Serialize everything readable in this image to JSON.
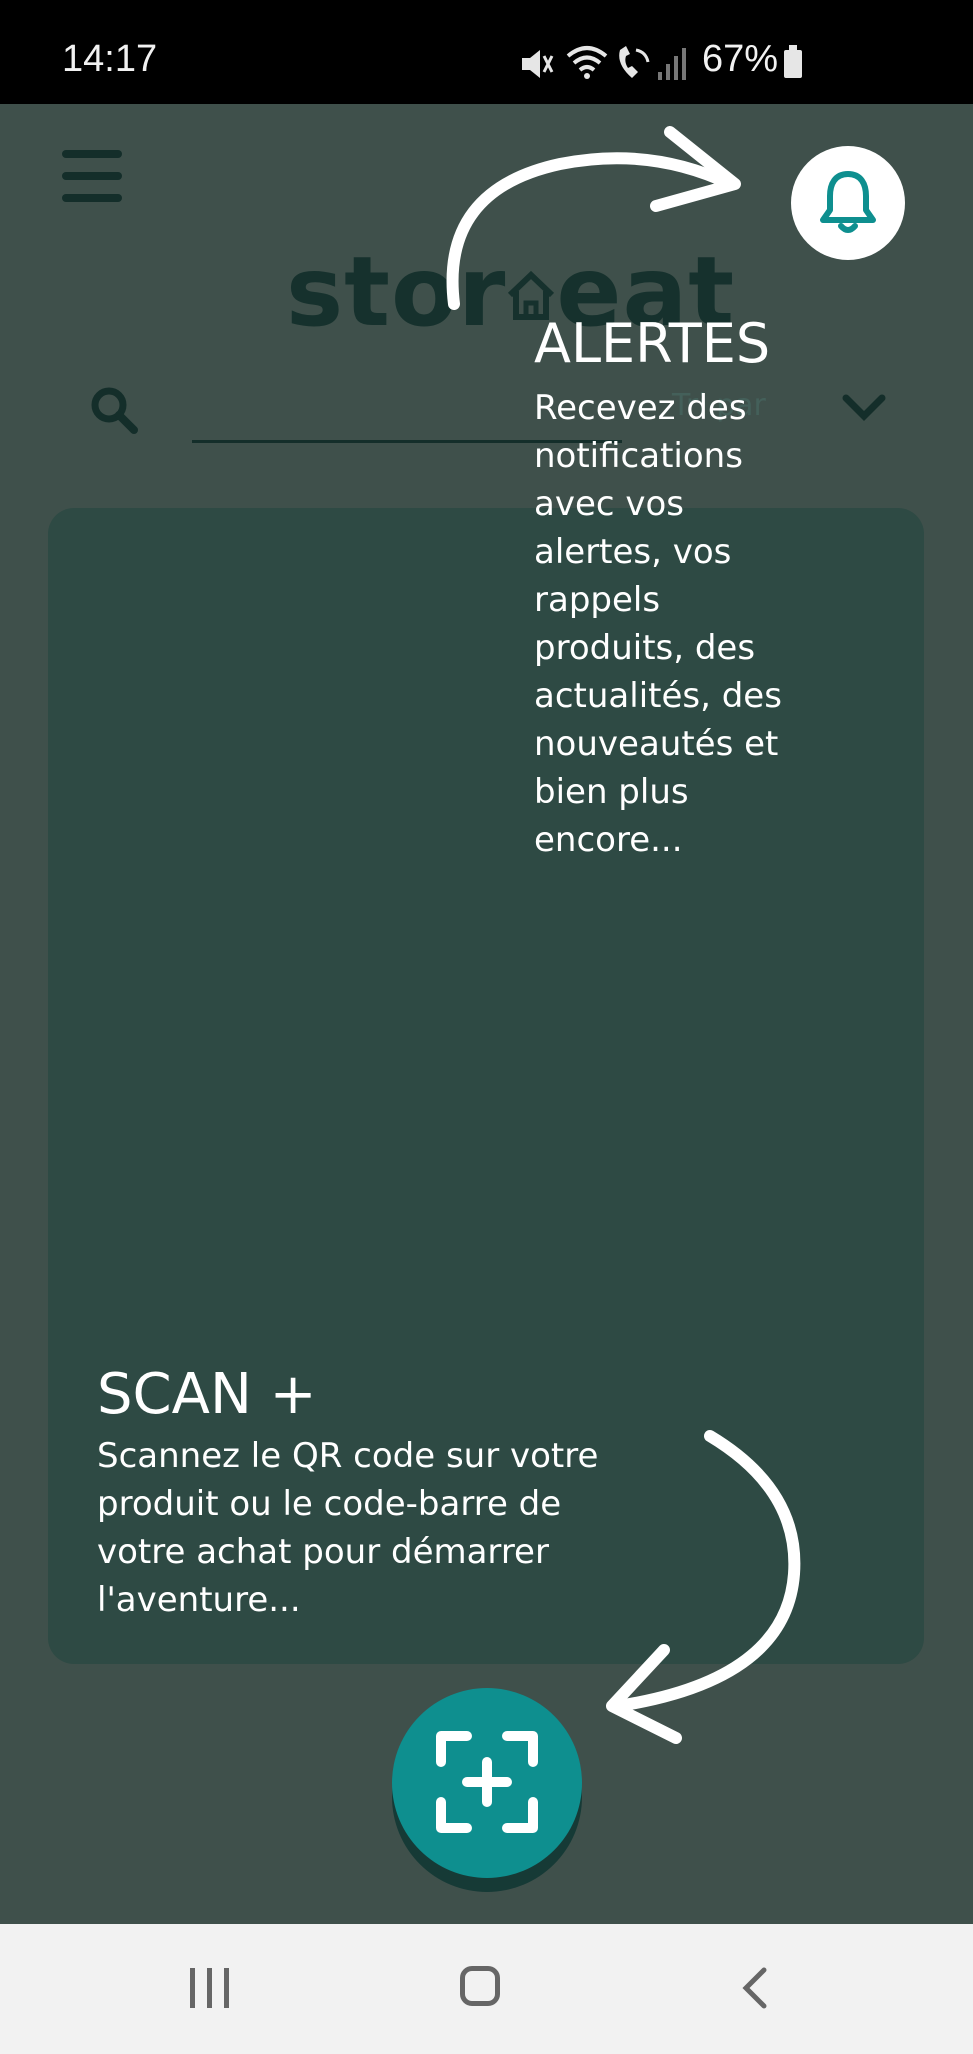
{
  "status_bar": {
    "time": "14:17",
    "battery_percent": "67%",
    "icons": [
      "mute-icon",
      "wifi-icon",
      "wifi-calling-icon",
      "signal-icon",
      "battery-icon"
    ]
  },
  "header": {
    "menu_icon": "hamburger-menu-icon",
    "logo_text_left": "stor",
    "logo_text_right": "eat",
    "logo_icon": "house-icon",
    "search_icon": "search-icon",
    "sort_label": "Tri par",
    "sort_icon": "chevron-down-icon"
  },
  "onboarding": {
    "alerts": {
      "icon": "bell-icon",
      "title": "ALERTES",
      "text": "Recevez des notifications avec vos alertes, vos rappels produits, des actualités, des nouveautés et bien plus encore..."
    },
    "scan": {
      "icon": "scan-plus-icon",
      "title": "SCAN +",
      "text": "Scannez le QR code sur votre produit ou le code-barre de votre achat pour démarrer l'aventure..."
    }
  },
  "colors": {
    "overlay_background": "#3f504b",
    "panel_background": "#2e4a44",
    "accent_teal": "#0e8f8f",
    "dark_green": "#16312d"
  },
  "nav_bar": {
    "icons": [
      "recent-apps-icon",
      "home-icon",
      "back-icon"
    ]
  }
}
